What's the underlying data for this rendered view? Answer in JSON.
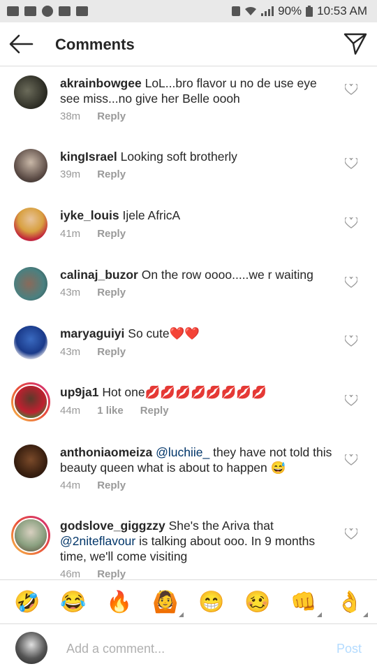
{
  "status_bar": {
    "battery": "90%",
    "time": "10:53 AM"
  },
  "header": {
    "title": "Comments"
  },
  "comments": [
    {
      "username": "akrainbowgee",
      "text": "LoL...bro flavor u no de use eye see miss...no give her Belle oooh",
      "time": "38m",
      "likes": "",
      "reply": "Reply"
    },
    {
      "username": "kingIsrael",
      "text": "Looking soft brotherly",
      "time": "39m",
      "likes": "",
      "reply": "Reply"
    },
    {
      "username": "iyke_louis",
      "text": "Ijele AfricA",
      "time": "41m",
      "likes": "",
      "reply": "Reply"
    },
    {
      "username": "calinaj_buzor",
      "text": "On the row oooo.....we r waiting",
      "time": "43m",
      "likes": "",
      "reply": "Reply"
    },
    {
      "username": "maryaguiyi",
      "text": "So cute❤️❤️",
      "time": "43m",
      "likes": "",
      "reply": "Reply"
    },
    {
      "username": "up9ja1",
      "text": "Hot one💋💋💋💋💋💋💋💋",
      "time": "44m",
      "likes": "1 like",
      "reply": "Reply"
    },
    {
      "username": "anthoniaomeiza",
      "mention": "@luchiie_",
      "text": "they have not told this beauty queen what is about to happen 😅",
      "time": "44m",
      "likes": "",
      "reply": "Reply"
    },
    {
      "username": "godslove_giggzzy",
      "text_before": "She's the Ariva that",
      "mention": "@2niteflavour",
      "text": "is talking about ooo. In 9 months time, we'll come visiting",
      "time": "46m",
      "likes": "",
      "reply": "Reply"
    }
  ],
  "emoji_bar": [
    "🤣",
    "😂",
    "🔥",
    "🙆",
    "😁",
    "🥴",
    "👊",
    "👌"
  ],
  "composer": {
    "placeholder": "Add a comment...",
    "post_label": "Post"
  },
  "colors": {
    "accent_disabled": "#b3dbff",
    "mention": "#003569",
    "meta": "#999999",
    "divider": "#dbdbdb"
  }
}
